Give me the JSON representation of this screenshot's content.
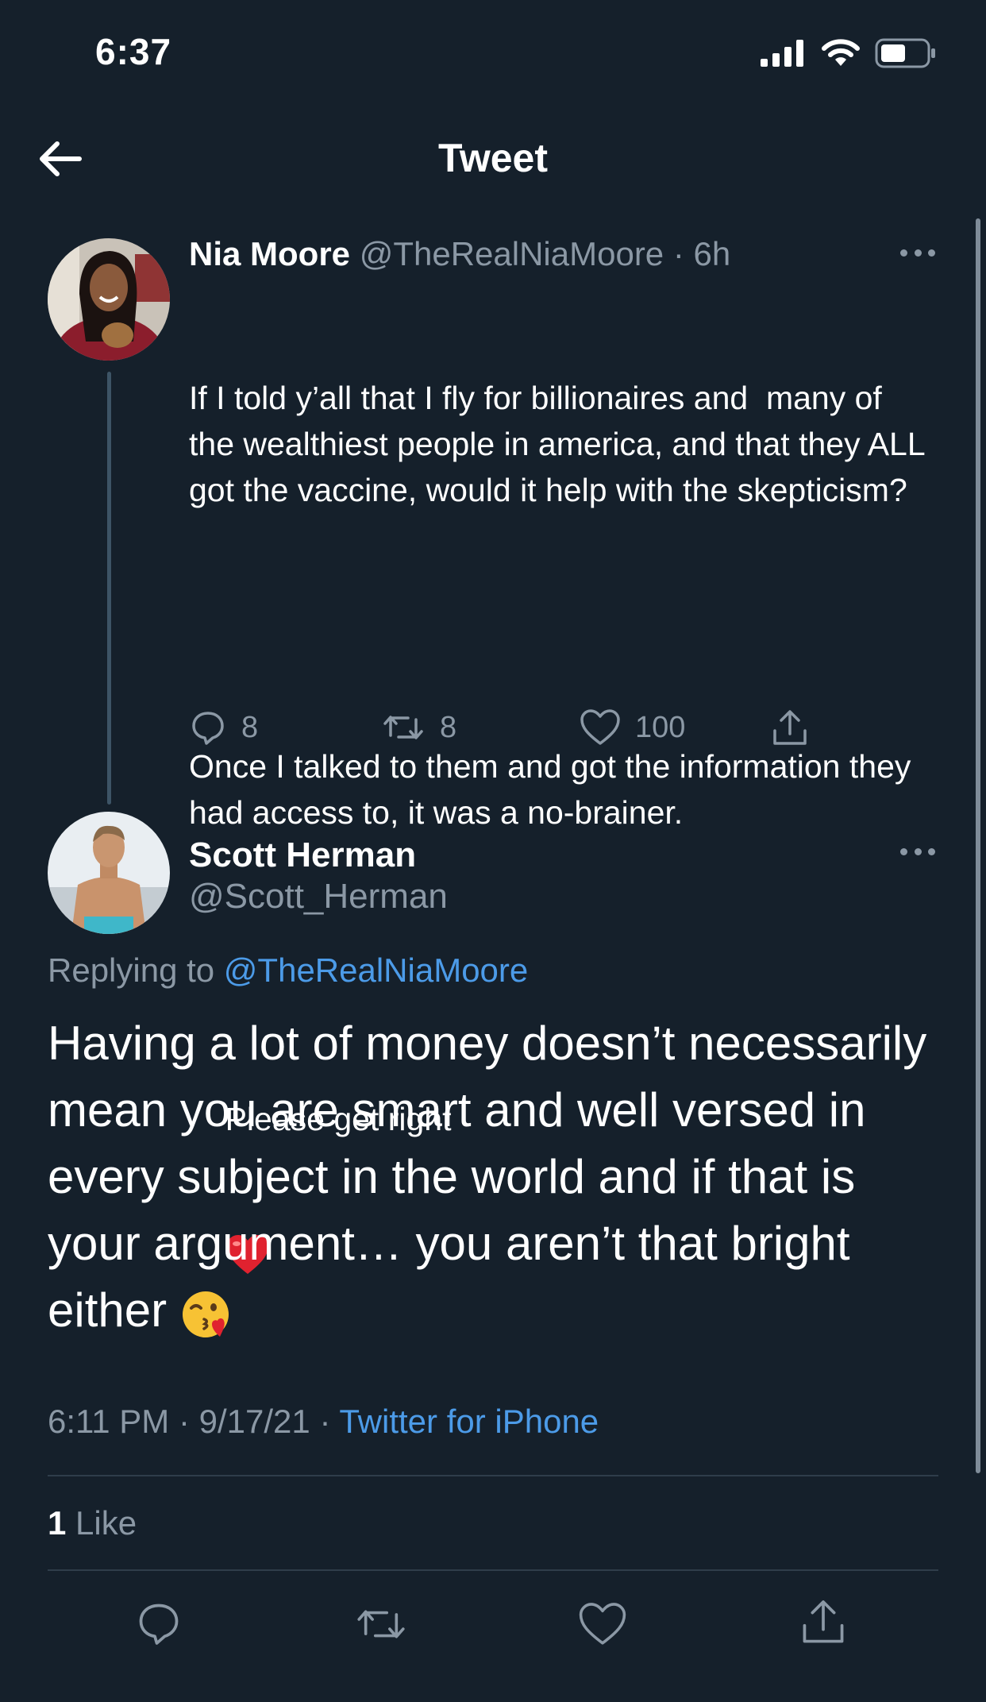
{
  "status_bar": {
    "time": "6:37"
  },
  "header": {
    "title": "Tweet"
  },
  "parent_tweet": {
    "author_name": "Nia Moore",
    "author_handle": "@TheRealNiaMoore",
    "age": "6h",
    "text_p1": "If I told y’all that I fly for billionaires and  many of the wealthiest people in america, and that they ALL got the vaccine, would it help with the skepticism?",
    "text_p2": "Once I talked to them and got the information they had access to, it was a no-brainer.",
    "text_p3": "Please get right",
    "text_p3_emoji": "red-heart",
    "reply_count": "8",
    "retweet_count": "8",
    "like_count": "100"
  },
  "main_tweet": {
    "author_name": "Scott Herman",
    "author_handle": "@Scott_Herman",
    "replying_label": "Replying to",
    "replying_to": "@TheRealNiaMoore",
    "text": "Having a lot of money doesn’t necessarily mean you are smart and well versed in every subject in the world and if that is your argument… you aren’t that bright either",
    "text_emoji": "face-blowing-kiss",
    "time": "6:11 PM",
    "date": "9/17/21",
    "source": "Twitter for iPhone",
    "like_count": "1",
    "like_label": "Like"
  },
  "colors": {
    "background": "#15202b",
    "muted": "#8b98a5",
    "link": "#4c9be8",
    "divider": "#2f3d4a"
  }
}
